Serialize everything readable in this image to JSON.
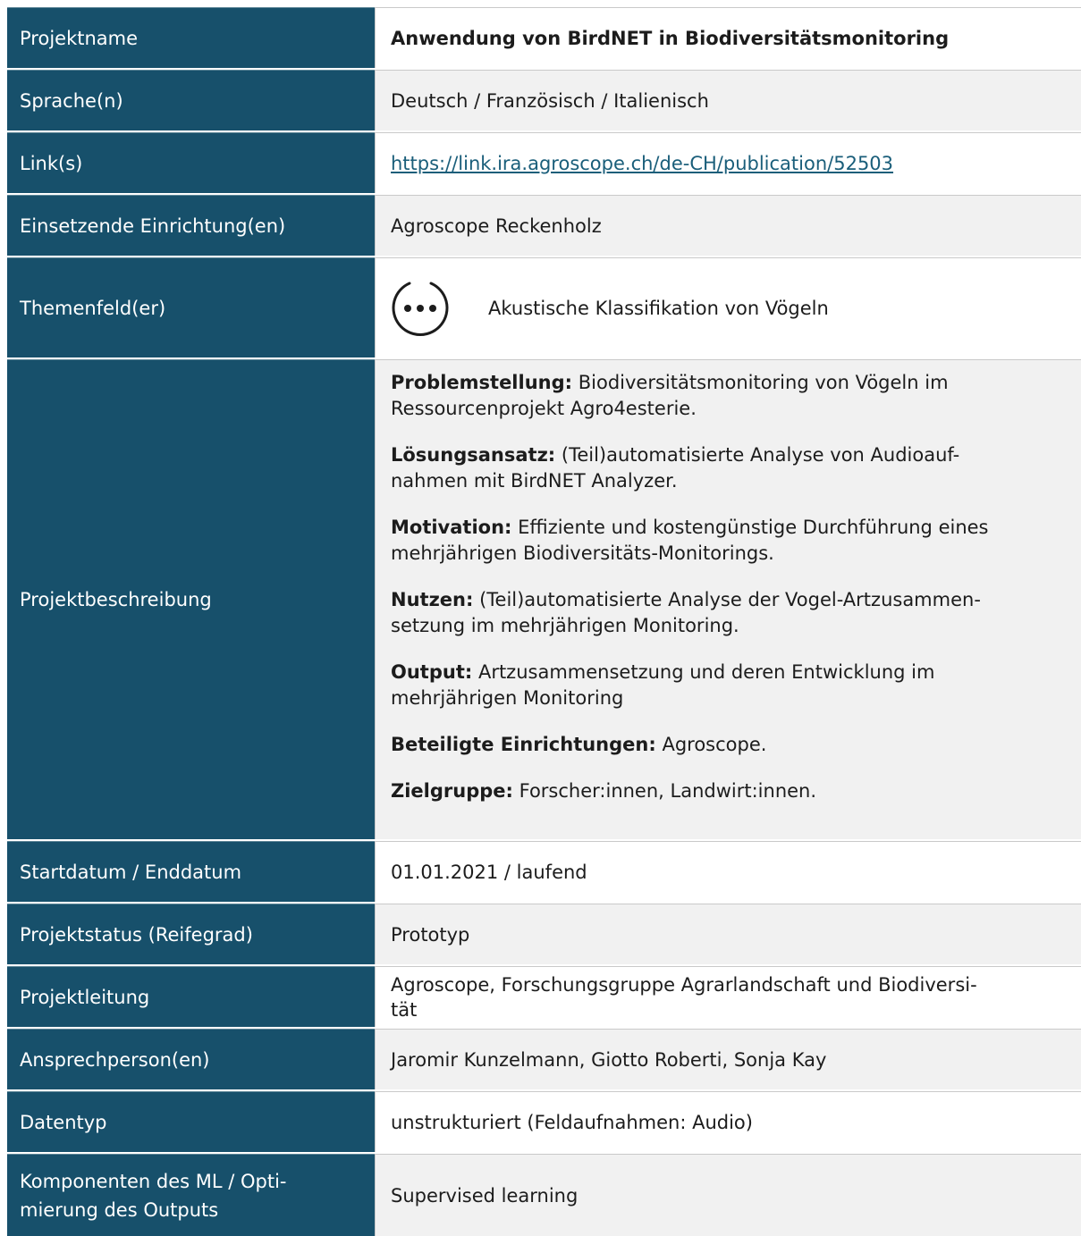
{
  "rows": {
    "projektname": {
      "label": "Projektname",
      "value": "Anwendung von BirdNET in Biodiversitätsmonitoring"
    },
    "sprache": {
      "label": "Sprache(n)",
      "value": "Deutsch / Französisch / Italienisch"
    },
    "link": {
      "label": "Link(s)",
      "value": "https://link.ira.agroscope.ch/de-CH/publication/52503"
    },
    "einrichtung": {
      "label": "Einsetzende Einrichtung(en)",
      "value": "Agroscope Reckenholz"
    },
    "themenfeld": {
      "label": "Themenfeld(er)",
      "value": "Akustische Klassifikation von Vögeln",
      "icon": "ellipsis-circle-icon"
    },
    "beschreibung": {
      "label": "Projektbeschreibung",
      "paragraphs": [
        {
          "heading": "Problemstellung:",
          "line1": "Biodiversitätsmonitoring von Vögeln im",
          "line2": "Ressourcenprojekt Agro4esterie."
        },
        {
          "heading": "Lösungsansatz:",
          "line1": "(Teil)automatisierte Analyse von Audioauf-",
          "line2": "nahmen mit BirdNET Analyzer."
        },
        {
          "heading": "Motivation:",
          "line1": "Effiziente und kostengünstige Durchführung eines",
          "line2": "mehrjährigen Biodiversitäts-Monitorings."
        },
        {
          "heading": "Nutzen:",
          "line1": "(Teil)automatisierte Analyse der Vogel-Artzusammen-",
          "line2": "setzung im mehrjährigen Monitoring."
        },
        {
          "heading": "Output:",
          "line1": "Artzusammensetzung und deren Entwicklung im",
          "line2": "mehrjährigen Monitoring"
        },
        {
          "heading": "Beteiligte Einrichtungen:",
          "line1": "Agroscope."
        },
        {
          "heading": "Zielgruppe:",
          "line1": "Forscher:innen, Landwirt:innen."
        }
      ]
    },
    "datum": {
      "label": "Startdatum / Enddatum",
      "value": "01.01.2021 / laufend"
    },
    "status": {
      "label": "Projektstatus (Reifegrad)",
      "value": "Prototyp"
    },
    "leitung": {
      "label": "Projektleitung",
      "line1": "Agroscope, Forschungsgruppe Agrarlandschaft und Biodiversi-",
      "line2": "tät"
    },
    "ansprech": {
      "label": "Ansprechperson(en)",
      "value": "Jaromir Kunzelmann, Giotto Roberti, Sonja Kay"
    },
    "datentyp": {
      "label": "Datentyp",
      "value": "unstrukturiert (Feldaufnahmen: Audio)"
    },
    "komponenten": {
      "label_line1": "Komponenten des ML / Opti-",
      "label_line2": "mierung des Outputs",
      "value": "Supervised learning"
    }
  },
  "colors": {
    "label_background": "#17506b",
    "label_text": "#ffffff",
    "value_background_alt": "#f1f1f1",
    "link": "#1a5e7a"
  }
}
